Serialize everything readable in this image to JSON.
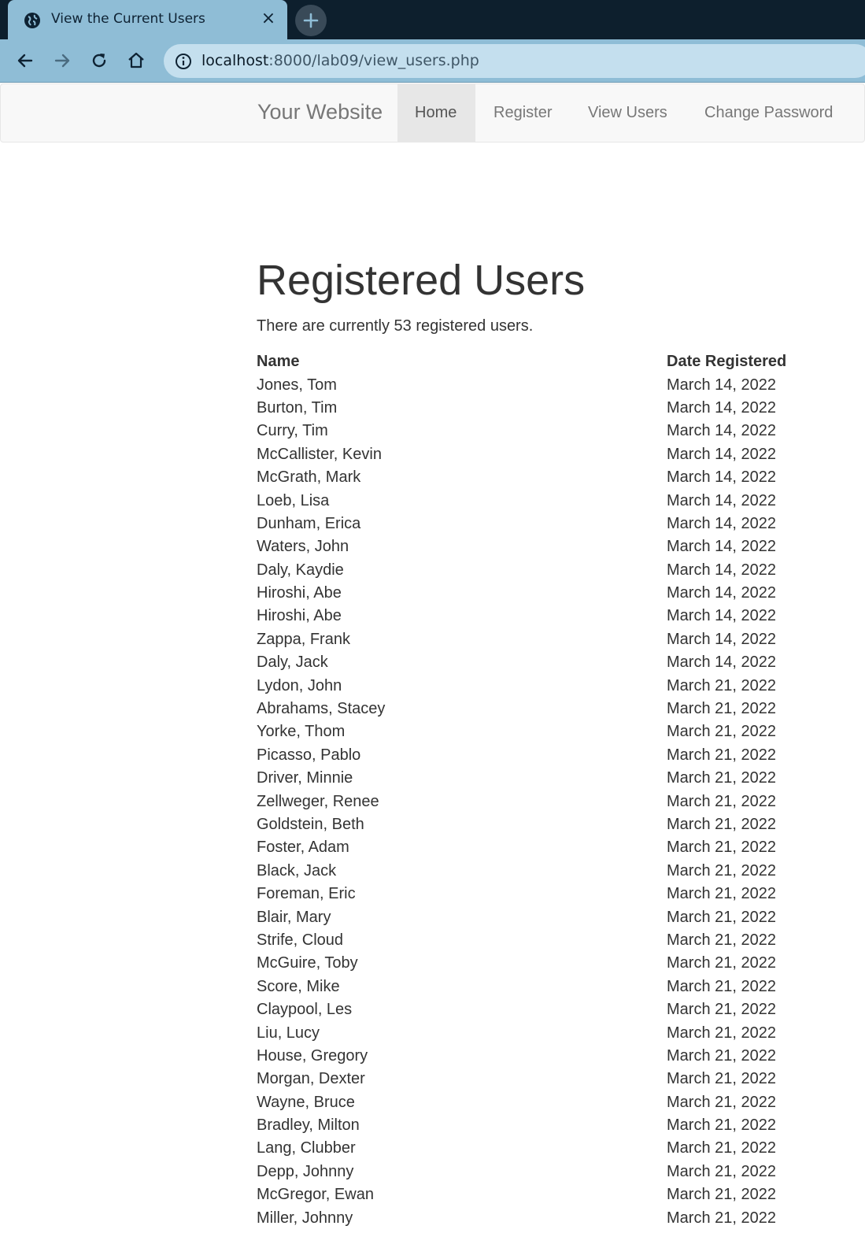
{
  "browser": {
    "tab_title": "View the Current Users",
    "url_host": "localhost",
    "url_path": ":8000/lab09/view_users.php"
  },
  "navbar": {
    "brand": "Your Website",
    "items": [
      {
        "label": "Home",
        "active": true
      },
      {
        "label": "Register",
        "active": false
      },
      {
        "label": "View Users",
        "active": false
      },
      {
        "label": "Change Password",
        "active": false
      }
    ]
  },
  "main": {
    "title": "Registered Users",
    "summary_prefix": "There are currently ",
    "user_count": "53",
    "summary_suffix": " registered users.",
    "columns": [
      "Name",
      "Date Registered"
    ],
    "rows": [
      [
        "Jones, Tom",
        "March 14, 2022"
      ],
      [
        "Burton, Tim",
        "March 14, 2022"
      ],
      [
        "Curry, Tim",
        "March 14, 2022"
      ],
      [
        "McCallister, Kevin",
        "March 14, 2022"
      ],
      [
        "McGrath, Mark",
        "March 14, 2022"
      ],
      [
        "Loeb, Lisa",
        "March 14, 2022"
      ],
      [
        "Dunham, Erica",
        "March 14, 2022"
      ],
      [
        "Waters, John",
        "March 14, 2022"
      ],
      [
        "Daly, Kaydie",
        "March 14, 2022"
      ],
      [
        "Hiroshi, Abe",
        "March 14, 2022"
      ],
      [
        "Hiroshi, Abe",
        "March 14, 2022"
      ],
      [
        "Zappa, Frank",
        "March 14, 2022"
      ],
      [
        "Daly, Jack",
        "March 14, 2022"
      ],
      [
        "Lydon, John",
        "March 21, 2022"
      ],
      [
        "Abrahams, Stacey",
        "March 21, 2022"
      ],
      [
        "Yorke, Thom",
        "March 21, 2022"
      ],
      [
        "Picasso, Pablo",
        "March 21, 2022"
      ],
      [
        "Driver, Minnie",
        "March 21, 2022"
      ],
      [
        "Zellweger, Renee",
        "March 21, 2022"
      ],
      [
        "Goldstein, Beth",
        "March 21, 2022"
      ],
      [
        "Foster, Adam",
        "March 21, 2022"
      ],
      [
        "Black, Jack",
        "March 21, 2022"
      ],
      [
        "Foreman, Eric",
        "March 21, 2022"
      ],
      [
        "Blair, Mary",
        "March 21, 2022"
      ],
      [
        "Strife, Cloud",
        "March 21, 2022"
      ],
      [
        "McGuire, Toby",
        "March 21, 2022"
      ],
      [
        "Score, Mike",
        "March 21, 2022"
      ],
      [
        "Claypool, Les",
        "March 21, 2022"
      ],
      [
        "Liu, Lucy",
        "March 21, 2022"
      ],
      [
        "House, Gregory",
        "March 21, 2022"
      ],
      [
        "Morgan, Dexter",
        "March 21, 2022"
      ],
      [
        "Wayne, Bruce",
        "March 21, 2022"
      ],
      [
        "Bradley, Milton",
        "March 21, 2022"
      ],
      [
        "Lang, Clubber",
        "March 21, 2022"
      ],
      [
        "Depp, Johnny",
        "March 21, 2022"
      ],
      [
        "McGregor, Ewan",
        "March 21, 2022"
      ],
      [
        "Miller, Johnny",
        "March 21, 2022"
      ]
    ]
  },
  "icons": {
    "tab_favicon": "globe-icon",
    "tab_close": "close-icon",
    "new_tab": "plus-icon",
    "back": "arrow-left-icon",
    "forward": "arrow-right-icon",
    "reload": "reload-icon",
    "home": "home-icon",
    "site_info": "info-icon"
  },
  "colors": {
    "tabstrip": "#0d1f2d",
    "toolbar": "#8fbdd6",
    "urlbar": "#c4dfee",
    "navbar_bg": "#f8f8f8",
    "nav_active_bg": "#e7e7e7",
    "text": "#333333",
    "nav_text": "#777777"
  }
}
